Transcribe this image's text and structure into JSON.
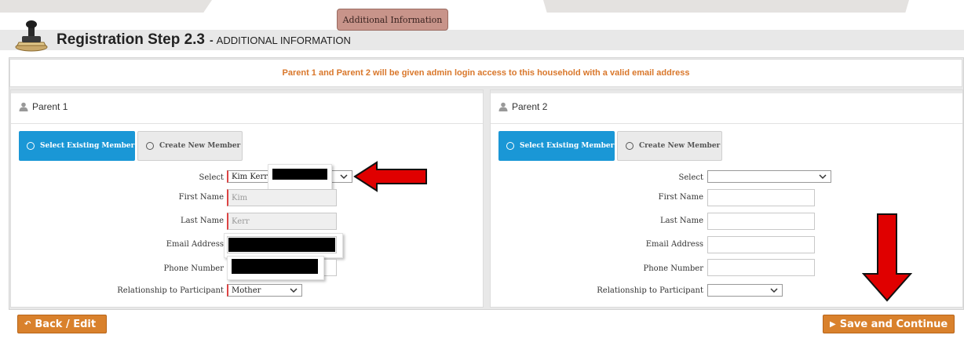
{
  "top_tab": {
    "label": "Additional Information"
  },
  "header": {
    "title": "Registration Step 2.3",
    "separator": "-",
    "subtitle": "ADDITIONAL INFORMATION"
  },
  "notice": {
    "text": "Parent 1 and Parent 2 will be given admin login access to this household with a valid email address"
  },
  "parent1": {
    "title": "Parent 1",
    "tab_select_existing": "Select Existing Member",
    "tab_create_new": "Create New Member",
    "labels": {
      "select": "Select",
      "first_name": "First Name",
      "last_name": "Last Name",
      "email": "Email Address",
      "phone": "Phone Number",
      "relationship": "Relationship to Participant"
    },
    "values": {
      "select": "Kim Kerr",
      "first_name": "Kim",
      "last_name": "Kerr",
      "email": "",
      "phone": "",
      "relationship": "Mother"
    }
  },
  "parent2": {
    "title": "Parent 2",
    "tab_select_existing": "Select Existing Member",
    "tab_create_new": "Create New Member",
    "labels": {
      "select": "Select",
      "first_name": "First Name",
      "last_name": "Last Name",
      "email": "Email Address",
      "phone": "Phone Number",
      "relationship": "Relationship to Participant"
    },
    "values": {
      "select": "",
      "first_name": "",
      "last_name": "",
      "email": "",
      "phone": "",
      "relationship": ""
    }
  },
  "footer": {
    "back_label": "Back / Edit",
    "save_label": "Save and Continue"
  },
  "colors": {
    "accent": "#d9812c",
    "active_tab": "#1a97d6",
    "notice_text": "#d9772b",
    "arrow": "#e00000"
  },
  "icons": [
    "stamp-icon",
    "user-icon",
    "radio-icon",
    "chevron-down-icon",
    "back-icon",
    "play-icon",
    "arrow-left-annotation",
    "arrow-down-annotation"
  ]
}
